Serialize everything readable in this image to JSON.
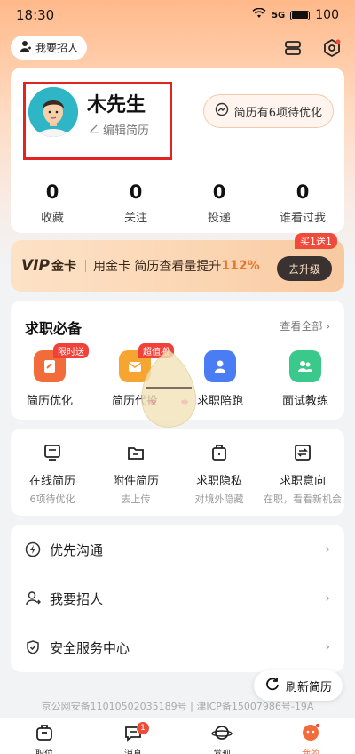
{
  "status_bar": {
    "time": "18:30",
    "signal": "5G",
    "battery": "100"
  },
  "header": {
    "recruit_label": "我要招人"
  },
  "profile": {
    "name": "木先生",
    "edit_label": "编辑简历",
    "optimize_label": "简历有6项待优化",
    "stats": [
      {
        "num": "0",
        "label": "收藏"
      },
      {
        "num": "0",
        "label": "关注"
      },
      {
        "num": "0",
        "label": "投递"
      },
      {
        "num": "0",
        "label": "谁看过我"
      }
    ]
  },
  "vip": {
    "mark": "VIP",
    "gold": "金卡",
    "text": "用金卡 简历查看量提升",
    "percent": "112%",
    "upgrade_label": "去升级",
    "promo": "买1送1"
  },
  "job_tools": {
    "title": "求职必备",
    "more": "查看全部",
    "items": [
      {
        "label": "简历优化",
        "tag": "限时送",
        "color": "#f26b3a"
      },
      {
        "label": "简历代投",
        "tag": "超值搬",
        "color": "#f7a531"
      },
      {
        "label": "求职陪跑",
        "tag": "",
        "color": "#4a7cf3"
      },
      {
        "label": "面试教练",
        "tag": "",
        "color": "#3bc98b"
      }
    ]
  },
  "resume_items": [
    {
      "title": "在线简历",
      "sub": "6项待优化"
    },
    {
      "title": "附件简历",
      "sub": "去上传"
    },
    {
      "title": "求职隐私",
      "sub": "对境外隐藏"
    },
    {
      "title": "求职意向",
      "sub": "在职，看看新机会"
    }
  ],
  "menu": [
    {
      "label": "优先沟通"
    },
    {
      "label": "我要招人"
    },
    {
      "label": "安全服务中心"
    }
  ],
  "refresh_label": "刷新简历",
  "footer": {
    "line": "京公网安备11010502035189号 | 津ICP备15007986号-19A"
  },
  "tabbar": [
    {
      "label": "职位"
    },
    {
      "label": "消息",
      "badge": "1"
    },
    {
      "label": "发现"
    },
    {
      "label": "我的"
    }
  ],
  "colors": {
    "accent": "#f26b3a",
    "highlight": "#e32222"
  }
}
